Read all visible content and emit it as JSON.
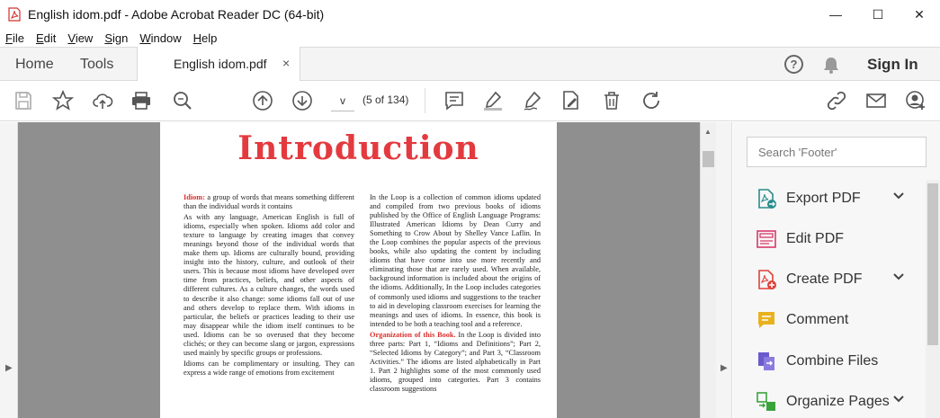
{
  "window": {
    "title": "English idom.pdf - Adobe Acrobat Reader DC (64-bit)",
    "controls": {
      "minimize": "—",
      "maximize": "☐",
      "close": "✕"
    }
  },
  "menu": {
    "items": [
      {
        "key": "F",
        "rest": "ile"
      },
      {
        "key": "E",
        "rest": "dit"
      },
      {
        "key": "V",
        "rest": "iew"
      },
      {
        "key": "S",
        "rest": "ign"
      },
      {
        "key": "W",
        "rest": "indow"
      },
      {
        "key": "H",
        "rest": "elp"
      }
    ]
  },
  "tabs": {
    "home": "Home",
    "tools": "Tools",
    "doc": "English idom.pdf",
    "doc_close": "×"
  },
  "header": {
    "help": "?",
    "signin": "Sign In"
  },
  "toolbar": {
    "page_input": "v",
    "page_count": "(5 of 134)"
  },
  "document": {
    "title": "Introduction",
    "left_col": [
      {
        "lead": "Idiom:",
        "text": " a group of words that means something different than the individual words it contains"
      },
      {
        "lead": "",
        "text": "As with any language, American English is full of idioms, especially when spoken. Idioms add color and texture to language by creating images that convey meanings beyond those of the individual words that make them up. Idioms are culturally bound, providing insight into the history, culture, and outlook of their users. This is because most idioms have developed over time from practices, beliefs, and other aspects of different cultures. As a culture changes, the words used to describe it also change: some idioms fall out of use and others develop to replace them. With idioms in particular, the beliefs or practices leading to their use may disappear while the idiom itself continues to be used. Idioms can be so overused that they become clichés; or they can become slang or jargon, expressions used mainly by specific groups or professions."
      },
      {
        "lead": "",
        "text": "Idioms can be complimentary or insulting. They can express a wide range of emotions from excitement"
      }
    ],
    "right_col": [
      {
        "lead": "",
        "text": "In the Loop is a collection of common idioms updated and compiled from two previous books of idioms published by the Office of English Language Programs: Illustrated American Idioms by Dean Curry and Something to Crow About by Shelley Vance Laflin. In the Loop combines the popular aspects of the previous books, while also updating the content by including idioms that have come into use more recently and eliminating those that are rarely used. When available, background information is included about the origins of the idioms. Additionally, In the Loop includes categories of commonly used idioms and suggestions to the teacher to aid in developing classroom exercises for learning the meanings and uses of idioms. In essence, this book is intended to be both a teaching tool and a reference."
      },
      {
        "lead": "Organization of this Book.",
        "text": " In the Loop is divided into three parts: Part 1, “Idioms and Definitions”; Part 2, “Selected Idioms by Category”; and Part 3, “Classroom Activities.” The idioms are listed alphabetically in Part 1. Part 2 highlights some of the most commonly used idioms, grouped into categories. Part 3 contains classroom suggestions"
      }
    ]
  },
  "panel": {
    "search_placeholder": "Search 'Footer'",
    "tools": [
      {
        "label": "Export PDF",
        "icon": "export-pdf-icon",
        "color": "#2a8c8c",
        "has_chevron": true
      },
      {
        "label": "Edit PDF",
        "icon": "edit-pdf-icon",
        "color": "#d8396a",
        "has_chevron": false
      },
      {
        "label": "Create PDF",
        "icon": "create-pdf-icon",
        "color": "#e0413a",
        "has_chevron": true
      },
      {
        "label": "Comment",
        "icon": "comment-icon",
        "color": "#e8b21f",
        "has_chevron": false
      },
      {
        "label": "Combine Files",
        "icon": "combine-files-icon",
        "color": "#6a5acd",
        "has_chevron": false
      },
      {
        "label": "Organize Pages",
        "icon": "organize-pages-icon",
        "color": "#3aa33a",
        "has_chevron": true
      }
    ]
  }
}
